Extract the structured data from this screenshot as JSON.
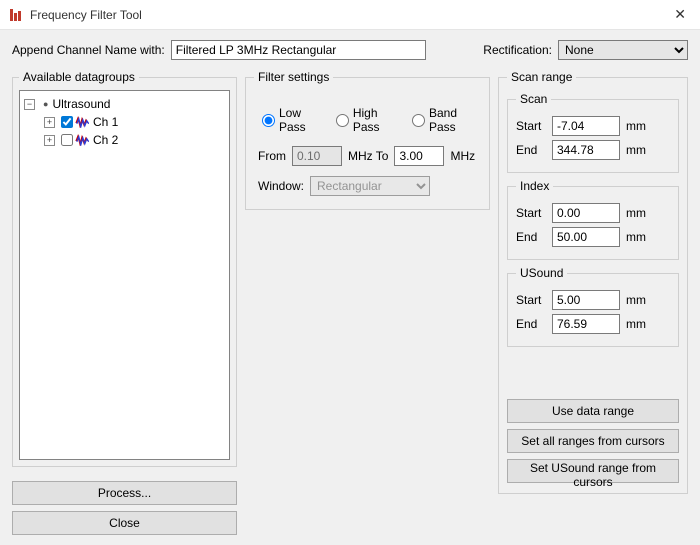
{
  "window": {
    "title": "Frequency Filter Tool",
    "close_glyph": "✕"
  },
  "toprow": {
    "append_label": "Append Channel Name with:",
    "append_value": "Filtered LP 3MHz Rectangular",
    "rectification_label": "Rectification:",
    "rectification_value": "None"
  },
  "left": {
    "group_label": "Available datagroups",
    "tree": {
      "root": {
        "label": "Ultrasound",
        "expander": "−",
        "bullet": "●"
      },
      "ch1": {
        "label": "Ch 1",
        "expander": "+",
        "checked": true
      },
      "ch2": {
        "label": "Ch 2",
        "expander": "+",
        "checked": false
      }
    },
    "process_label": "Process...",
    "close_label": "Close"
  },
  "filter": {
    "group_label": "Filter settings",
    "low_pass": "Low Pass",
    "high_pass": "High Pass",
    "band_pass": "Band Pass",
    "selected": "low",
    "from_label": "From",
    "from_value": "0.10",
    "mhz_to": "MHz To",
    "to_value": "3.00",
    "mhz": "MHz",
    "window_label": "Window:",
    "window_value": "Rectangular"
  },
  "scan": {
    "group_label": "Scan range",
    "unit": "mm",
    "start_label": "Start",
    "end_label": "End",
    "sections": {
      "scan": {
        "title": "Scan",
        "start": "-7.04",
        "end": "344.78"
      },
      "index": {
        "title": "Index",
        "start": "0.00",
        "end": "50.00"
      },
      "usound": {
        "title": "USound",
        "start": "5.00",
        "end": "76.59"
      }
    },
    "btn_use_data_range": "Use data range",
    "btn_set_all_cursors": "Set all ranges from cursors",
    "btn_set_usound_cursors": "Set USound range from cursors"
  }
}
